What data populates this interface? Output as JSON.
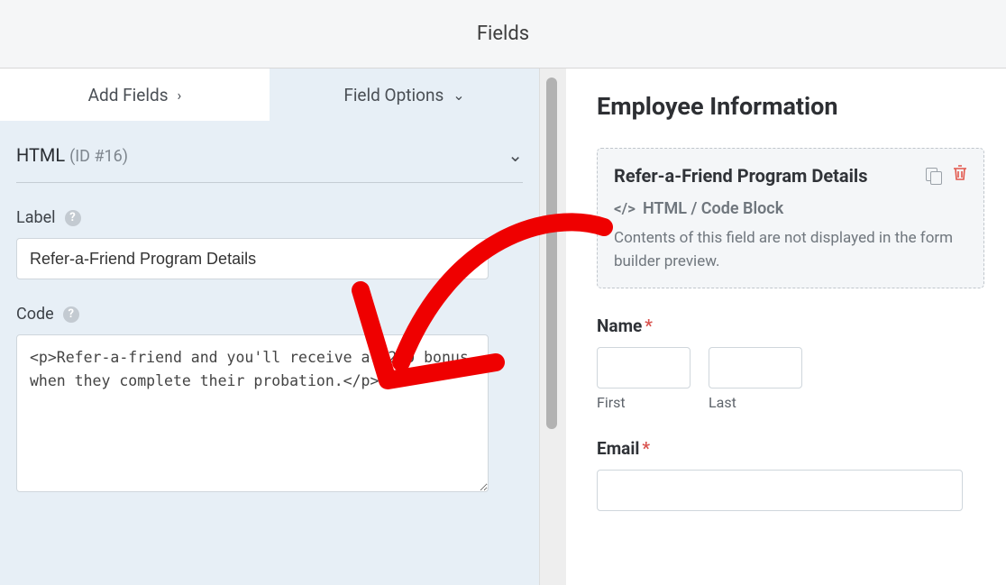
{
  "header": {
    "title": "Fields"
  },
  "tabs": {
    "add_label": "Add Fields",
    "options_label": "Field Options"
  },
  "options": {
    "field_type": "HTML",
    "field_id": "(ID #16)",
    "label_heading": "Label",
    "label_value": "Refer-a-Friend Program Details",
    "code_heading": "Code",
    "code_value": "<p>Refer-a-friend and you'll receive a $200 bonus when they complete their probation.</p>"
  },
  "preview": {
    "form_title": "Employee Information",
    "html_block": {
      "title": "Refer-a-Friend Program Details",
      "subtitle": "HTML / Code Block",
      "description": "Contents of this field are not displayed in the form builder preview."
    },
    "name_field": {
      "label": "Name",
      "first_sub": "First",
      "last_sub": "Last"
    },
    "email_field": {
      "label": "Email"
    }
  }
}
